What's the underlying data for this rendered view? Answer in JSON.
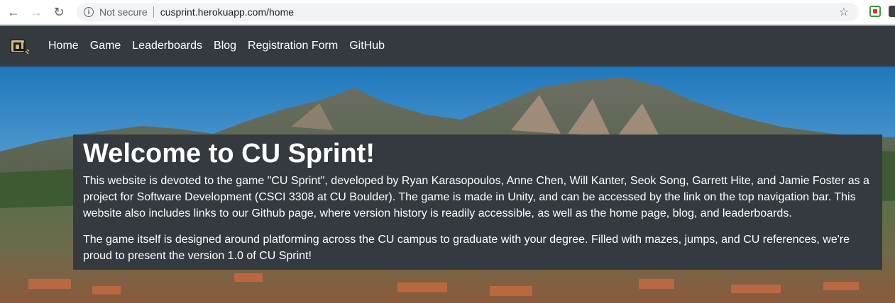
{
  "browser": {
    "security_label": "Not secure",
    "url": "cusprint.herokuapp.com/home"
  },
  "navbar": {
    "links": [
      "Home",
      "Game",
      "Leaderboards",
      "Blog",
      "Registration Form",
      "GitHub"
    ]
  },
  "welcome": {
    "title": "Welcome to CU Sprint!",
    "paragraph1": "This website is devoted to the game \"CU Sprint\", developed by Ryan Karasopoulos, Anne Chen, Will Kanter, Seok Song, Garrett Hite, and Jamie Foster as a project for Software Development (CSCI 3308 at CU Boulder). The game is made in Unity, and can be accessed by the link on the top navigation bar. This website also includes links to our Github page, where version history is readily accessible, as well as the home page, blog, and leaderboards.",
    "paragraph2": "The game itself is designed around platforming across the CU campus to graduate with your degree. Filled with mazes, jumps, and CU references, we're proud to present the version 1.0 of CU Sprint!"
  },
  "colors": {
    "navbar_bg": "#343a40",
    "panel_bg": "#343a40",
    "text": "#ffffff"
  }
}
